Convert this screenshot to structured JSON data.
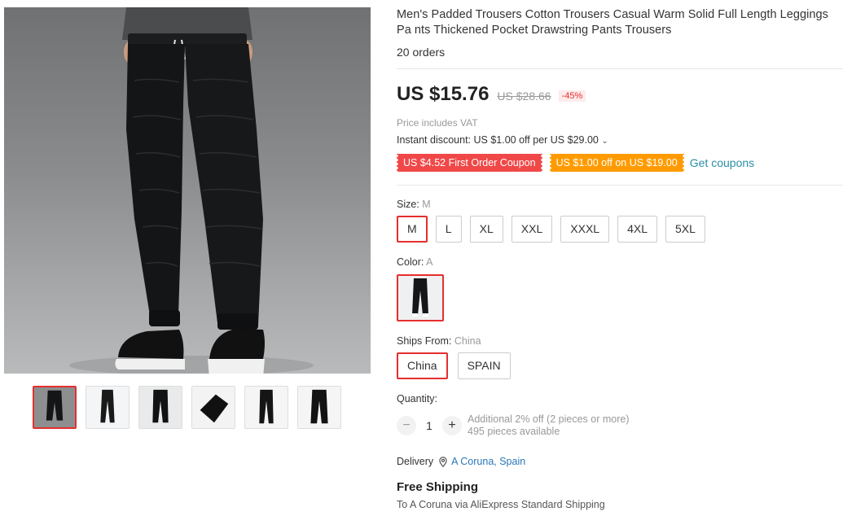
{
  "product": {
    "title": "Men's Padded Trousers Cotton Trousers Casual Warm Solid Full Length Leggings Pa nts Thickened Pocket Drawstring Pants Trousers",
    "orders": "20 orders"
  },
  "price": {
    "current": "US $15.76",
    "original": "US $28.66",
    "discount": "-45%",
    "vat_note": "Price includes VAT",
    "instant_discount": "Instant discount: US $1.00 off per US $29.00",
    "instant_chevron": "⌄"
  },
  "coupons": {
    "first_order": "US $4.52 First Order Coupon",
    "store": "US $1.00 off on US $19.00",
    "get_coupons": "Get coupons"
  },
  "size": {
    "label": "Size: ",
    "selected": "M",
    "options": [
      "M",
      "L",
      "XL",
      "XXL",
      "XXXL",
      "4XL",
      "5XL"
    ]
  },
  "color": {
    "label": "Color: ",
    "selected": "A"
  },
  "ships_from": {
    "label": "Ships From: ",
    "selected": "China",
    "options": [
      "China",
      "SPAIN"
    ]
  },
  "quantity": {
    "label": "Quantity:",
    "minus": "−",
    "value": "1",
    "plus": "+",
    "note_line1": "Additional 2% off (2 pieces or more)",
    "note_line2": "495 pieces available"
  },
  "delivery": {
    "label": "Delivery",
    "location": "A Coruna, Spain",
    "free_shipping": "Free Shipping",
    "shipping_desc": "To A Coruna via AliExpress Standard Shipping"
  },
  "colors": {
    "accent_red": "#e62e2e",
    "coupon_red": "#f04848",
    "coupon_orange": "#ff9b00",
    "link_teal": "#2a8ea6",
    "link_blue": "#2a76b8"
  },
  "icons": {
    "location": "map-pin-icon"
  }
}
